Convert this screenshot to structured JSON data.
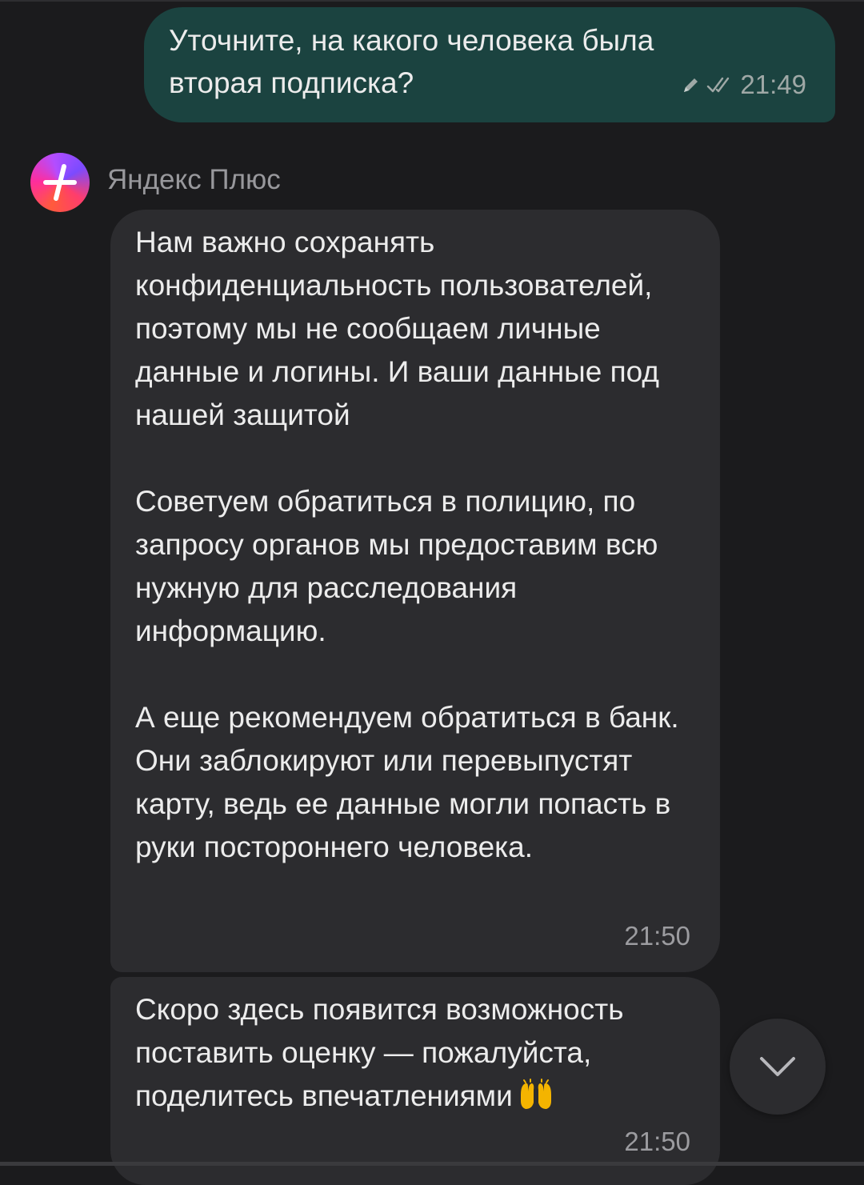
{
  "outgoing": {
    "text": "Уточните, на какого человека была\nвторая подписка?",
    "time": "21:49",
    "edited_icon": "pencil-icon",
    "status_icon": "double-check-icon"
  },
  "sender": {
    "name": "Яндекс Плюс",
    "avatar_icon": "plus-logo-icon"
  },
  "incoming": [
    {
      "paragraphs": [
        "Нам важно сохранять конфиденциальность пользователей, поэтому мы не сообщаем личные данные и логины. И ваши данные под нашей защитой",
        "Советуем обратиться в полицию, по запросу органов мы предоставим всю нужную для расследования информацию.",
        "А еще рекомендуем обратиться в банк. Они заблокируют или перевыпустят карту, ведь ее данные могли попасть в руки постороннего человека."
      ],
      "time": "21:50"
    },
    {
      "text": "Скоро здесь появится возможность поставить оценку — пожалуйста, поделитесь впечатлениями",
      "emoji": "raising-hands-icon",
      "time": "21:50"
    }
  ],
  "scroll_button": {
    "icon": "chevron-down-icon"
  },
  "colors": {
    "background": "#1b1b1d",
    "outgoing_bubble": "#1b4340",
    "incoming_bubble": "#2c2c2f",
    "text": "#ececec",
    "meta_text": "#9c9ca0"
  }
}
